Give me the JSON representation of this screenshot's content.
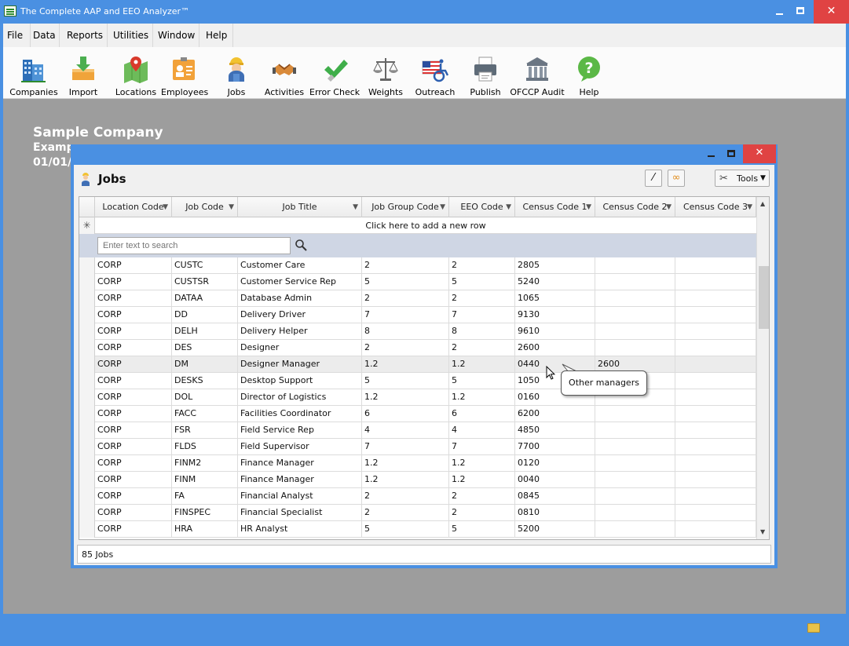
{
  "app": {
    "title": "The Complete AAP and EEO Analyzer™"
  },
  "menu": [
    "File",
    "Data",
    "Reports",
    "Utilities",
    "Window",
    "Help"
  ],
  "toolbar": [
    {
      "label": "Companies",
      "icon": "companies-icon"
    },
    {
      "label": "Import",
      "icon": "import-icon"
    },
    {
      "label": "Locations",
      "icon": "locations-icon"
    },
    {
      "label": "Employees",
      "icon": "employees-icon"
    },
    {
      "label": "Jobs",
      "icon": "jobs-icon"
    },
    {
      "label": "Activities",
      "icon": "activities-icon"
    },
    {
      "label": "Error Check",
      "icon": "error-check-icon"
    },
    {
      "label": "Weights",
      "icon": "weights-icon"
    },
    {
      "label": "Outreach",
      "icon": "outreach-icon"
    },
    {
      "label": "Publish",
      "icon": "publish-icon"
    },
    {
      "label": "OFCCP Audit",
      "icon": "ofccp-audit-icon"
    },
    {
      "label": "Help",
      "icon": "help-icon"
    }
  ],
  "company": {
    "name": "Sample Company",
    "line2": "Examp",
    "line3": "01/01/"
  },
  "jobs_window": {
    "heading": "Jobs",
    "tools_label": "Tools",
    "columns": [
      "Location Code",
      "Job Code",
      "Job Title",
      "Job Group Code",
      "EEO Code",
      "Census Code 1",
      "Census Code 2",
      "Census Code 3"
    ],
    "add_row_text": "Click here to add a new row",
    "search_placeholder": "Enter text to search",
    "rows": [
      [
        "CORP",
        "CUSTC",
        "Customer Care",
        "2",
        "2",
        "2805",
        "",
        ""
      ],
      [
        "CORP",
        "CUSTSR",
        "Customer Service Rep",
        "5",
        "5",
        "5240",
        "",
        ""
      ],
      [
        "CORP",
        "DATAA",
        "Database Admin",
        "2",
        "2",
        "1065",
        "",
        ""
      ],
      [
        "CORP",
        "DD",
        "Delivery Driver",
        "7",
        "7",
        "9130",
        "",
        ""
      ],
      [
        "CORP",
        "DELH",
        "Delivery Helper",
        "8",
        "8",
        "9610",
        "",
        ""
      ],
      [
        "CORP",
        "DES",
        "Designer",
        "2",
        "2",
        "2600",
        "",
        ""
      ],
      [
        "CORP",
        "DM",
        "Designer Manager",
        "1.2",
        "1.2",
        "0440",
        "2600",
        ""
      ],
      [
        "CORP",
        "DESKS",
        "Desktop Support",
        "5",
        "5",
        "1050",
        "",
        ""
      ],
      [
        "CORP",
        "DOL",
        "Director of Logistics",
        "1.2",
        "1.2",
        "0160",
        "",
        ""
      ],
      [
        "CORP",
        "FACC",
        "Facilities Coordinator",
        "6",
        "6",
        "6200",
        "",
        ""
      ],
      [
        "CORP",
        "FSR",
        "Field Service Rep",
        "4",
        "4",
        "4850",
        "",
        ""
      ],
      [
        "CORP",
        "FLDS",
        "Field Supervisor",
        "7",
        "7",
        "7700",
        "",
        ""
      ],
      [
        "CORP",
        "FINM2",
        "Finance Manager",
        "1.2",
        "1.2",
        "0120",
        "",
        ""
      ],
      [
        "CORP",
        "FINM",
        "Finance Manager",
        "1.2",
        "1.2",
        "0040",
        "",
        ""
      ],
      [
        "CORP",
        "FA",
        "Financial Analyst",
        "2",
        "2",
        "0845",
        "",
        ""
      ],
      [
        "CORP",
        "FINSPEC",
        "Financial Specialist",
        "2",
        "2",
        "0810",
        "",
        ""
      ],
      [
        "CORP",
        "HRA",
        "HR Analyst",
        "5",
        "5",
        "5200",
        "",
        ""
      ]
    ],
    "count_text": "85 Jobs",
    "tooltip": "Other managers"
  },
  "colors": {
    "titlebar": "#4a90e2",
    "close": "#e04343",
    "workspace": "#9d9d9d"
  }
}
